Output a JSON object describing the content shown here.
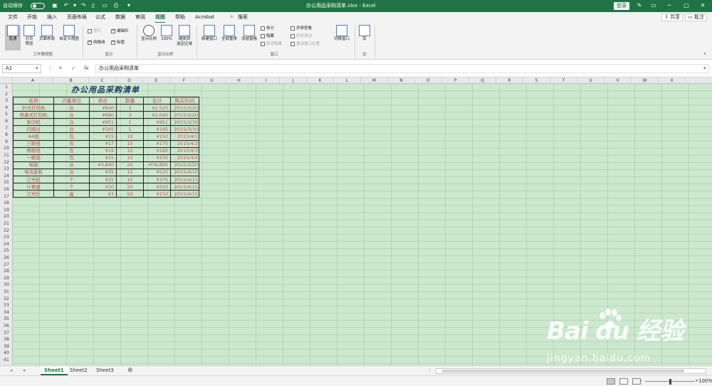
{
  "titlebar": {
    "autosave_label": "自动保存",
    "autosave_state": "关",
    "filename": "办公用品采购清单.xlsx  -  Excel",
    "search_label": "搜索",
    "login_label": "登录",
    "accent": "#217346"
  },
  "tabs": [
    "文件",
    "开始",
    "插入",
    "页面布局",
    "公式",
    "数据",
    "审阅",
    "视图",
    "帮助",
    "Acrobat"
  ],
  "active_tab": "视图",
  "share_label": "共享",
  "comment_label": "批注",
  "ribbon": {
    "views": {
      "normal": "普通",
      "pagebreak": "分页\n预览",
      "pagelayout": "页面布局",
      "custom": "自定义视图"
    },
    "group_views": "工作簿视图",
    "show": {
      "ruler": "直尺",
      "gridlines": "网格线",
      "formula_bar": "编辑栏",
      "headings": "标题"
    },
    "group_show": "显示",
    "zoom": {
      "zoom": "显示比例",
      "hundred": "100%",
      "to_selection": "缩放到\n选定区域"
    },
    "group_zoom": "显示比例",
    "window": {
      "new": "新建窗口",
      "arrange": "全部重排",
      "freeze": "冻结窗格",
      "split": "拆分",
      "hide": "隐藏",
      "unhide": "取消隐藏",
      "side_by_side": "并排查看",
      "sync_scroll": "同步滚动",
      "reset_pos": "重设窗口位置",
      "switch": "切换窗口"
    },
    "group_window": "窗口",
    "macros": "宏",
    "group_macros": "宏"
  },
  "formula_bar": {
    "name_box": "A1",
    "fx": "fx",
    "content": "办公用品采购清单"
  },
  "columns": [
    "A",
    "B",
    "C",
    "D",
    "E",
    "F",
    "G",
    "H",
    "I",
    "J",
    "K",
    "L",
    "M",
    "N",
    "O",
    "P",
    "Q",
    "R",
    "S",
    "T",
    "U",
    "V",
    "W",
    "X"
  ],
  "rows": [
    "1",
    "2",
    "3",
    "4",
    "5",
    "6",
    "7",
    "8",
    "9",
    "10",
    "11",
    "12",
    "13",
    "14",
    "15",
    "16",
    "17",
    "18",
    "19",
    "20",
    "21",
    "22",
    "23",
    "24",
    "25",
    "26",
    "27",
    "28",
    "29",
    "30",
    "31",
    "32",
    "33",
    "34",
    "35",
    "36",
    "37",
    "38",
    "39",
    "40",
    "41"
  ],
  "sheet_title": "办公用品采购清单",
  "table": {
    "headers": [
      "名称",
      "计量单位",
      "单价",
      "数量",
      "合计",
      "购买时间"
    ],
    "rows": [
      [
        "针式打印机",
        "台",
        "¥840",
        "3",
        "¥2,520",
        "2015/3/20"
      ],
      [
        "喷墨式打印机",
        "台",
        "¥680",
        "3",
        "¥2,040",
        "2015/3/20"
      ],
      [
        "复印机",
        "台",
        "¥951",
        "1",
        "¥951",
        "2015/3/30"
      ],
      [
        "扫描仪",
        "台",
        "¥345",
        "1",
        "¥345",
        "2015/3/30"
      ],
      [
        "A4纸",
        "包",
        "¥15",
        "10",
        "¥150",
        "2015/4/1"
      ],
      [
        "三联纸",
        "包",
        "¥17",
        "10",
        "¥170",
        "2015/4/2"
      ],
      [
        "两联纸",
        "包",
        "¥16",
        "10",
        "¥160",
        "2015/4/3"
      ],
      [
        "一联纸",
        "包",
        "¥15",
        "10",
        "¥150",
        "2015/4/4"
      ],
      [
        "电脑",
        "台",
        "¥3,840",
        "20",
        "¥76,800",
        "2015/2/20"
      ],
      [
        "电话座机",
        "台",
        "¥35",
        "15",
        "¥525",
        "2015/4/10"
      ],
      [
        "订书机",
        "个",
        "¥25",
        "15",
        "¥375",
        "2015/4/15"
      ],
      [
        "计算器",
        "个",
        "¥10",
        "25",
        "¥250",
        "2015/4/15"
      ],
      [
        "订书针",
        "盒",
        "¥3",
        "50",
        "¥150",
        "2015/4/15"
      ]
    ]
  },
  "sheet_tabs": [
    "Sheet1",
    "Sheet2",
    "Sheet3"
  ],
  "active_sheet": "Sheet1",
  "status": {
    "zoom": "100%"
  },
  "watermark": {
    "logo": "Bai du 经验",
    "url": "jingyan.baidu.com"
  }
}
